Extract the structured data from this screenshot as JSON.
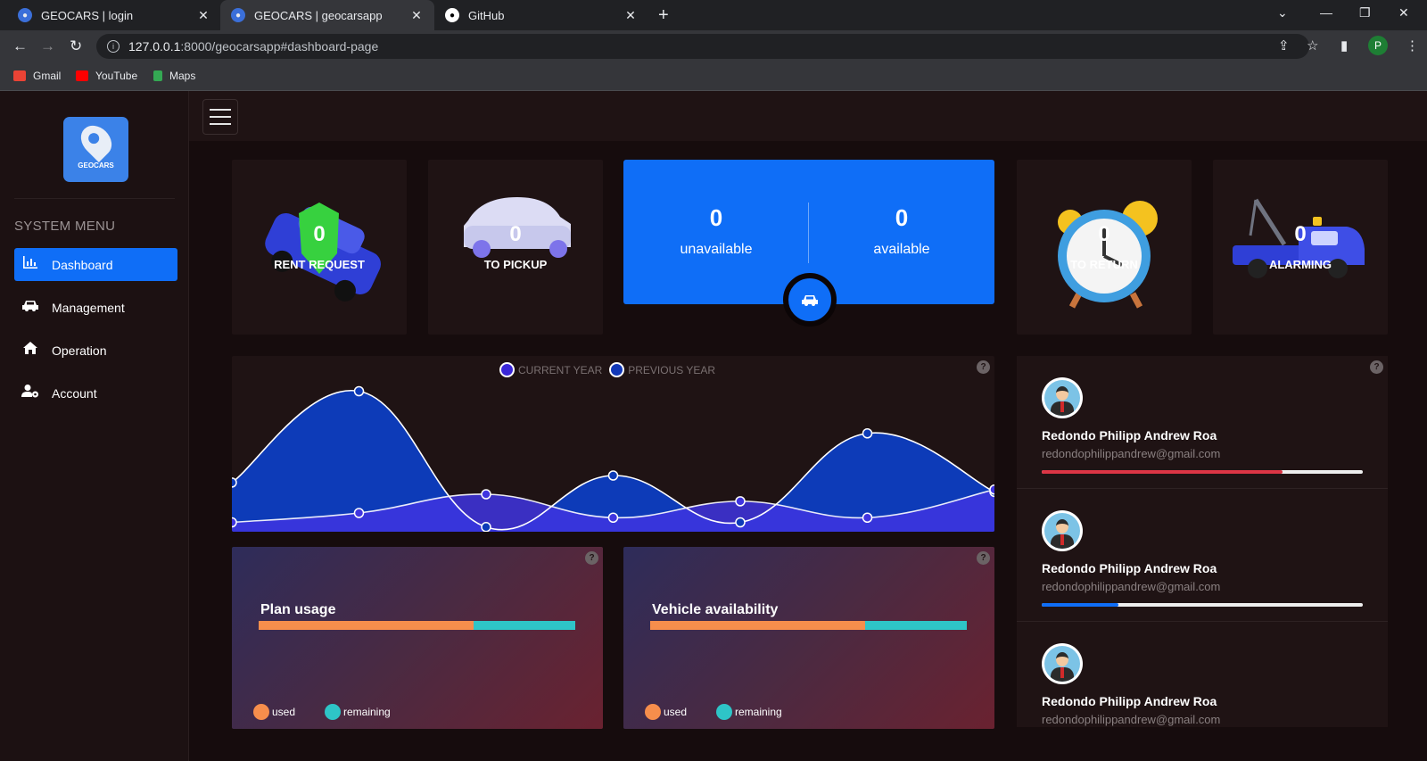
{
  "browser": {
    "tabs": [
      {
        "title": "GEOCARS | login",
        "active": false
      },
      {
        "title": "GEOCARS | geocarsapp",
        "active": true
      },
      {
        "title": "GitHub",
        "active": false
      }
    ],
    "url_host": "127.0.0.1",
    "url_rest": ":8000/geocarsapp#dashboard-page",
    "profile_initial": "P",
    "bookmarks": [
      "Gmail",
      "YouTube",
      "Maps"
    ]
  },
  "sidebar": {
    "logo_text": "GEOCARS",
    "menu_title": "SYSTEM MENU",
    "items": [
      {
        "label": "Dashboard",
        "icon": "chart-icon",
        "active": true
      },
      {
        "label": "Management",
        "icon": "car-icon",
        "active": false
      },
      {
        "label": "Operation",
        "icon": "home-icon",
        "active": false
      },
      {
        "label": "Account",
        "icon": "user-gear-icon",
        "active": false
      }
    ]
  },
  "stats": {
    "rent_request": {
      "value": "0",
      "label": "RENT REQUEST"
    },
    "to_pickup": {
      "value": "0",
      "label": "TO PICKUP"
    },
    "to_return": {
      "value": "0",
      "label": "TO RETURN"
    },
    "alarming": {
      "value": "0",
      "label": "ALARMING"
    },
    "availability": {
      "unavailable_value": "0",
      "unavailable_label": "unavailable",
      "available_value": "0",
      "available_label": "available"
    }
  },
  "chart_data": {
    "type": "area",
    "legend": [
      "CURRENT YEAR",
      "PREVIOUS YEAR"
    ],
    "series": [
      {
        "name": "CURRENT YEAR",
        "values": [
          0.2,
          0.4,
          0.8,
          0.3,
          0.65,
          0.3,
          0.9
        ]
      },
      {
        "name": "PREVIOUS YEAR",
        "values": [
          1.05,
          3.0,
          0.1,
          1.2,
          0.2,
          2.1,
          0.85
        ]
      }
    ],
    "x": [
      0,
      1,
      2,
      3,
      4,
      5,
      6
    ],
    "ylim": [
      0,
      3.6
    ],
    "colors": {
      "current": "#4035e0",
      "previous": "#0d3bb8"
    }
  },
  "plan_usage": {
    "title": "Plan usage",
    "used_fraction": 0.68,
    "legend_used": "used",
    "legend_remaining": "remaining"
  },
  "vehicle_availability": {
    "title": "Vehicle availability",
    "used_fraction": 0.68,
    "legend_used": "used",
    "legend_remaining": "remaining"
  },
  "users": [
    {
      "name": "Redondo Philipp Andrew Roa",
      "email": "redondophilippandrew@gmail.com",
      "progress": 0.75,
      "color": "#dc3545"
    },
    {
      "name": "Redondo Philipp Andrew Roa",
      "email": "redondophilippandrew@gmail.com",
      "progress": 0.24,
      "color": "#0f6ef7"
    },
    {
      "name": "Redondo Philipp Andrew Roa",
      "email": "redondophilippandrew@gmail.com",
      "progress": 0.0,
      "color": "#0f6ef7"
    }
  ],
  "help_symbol": "?"
}
